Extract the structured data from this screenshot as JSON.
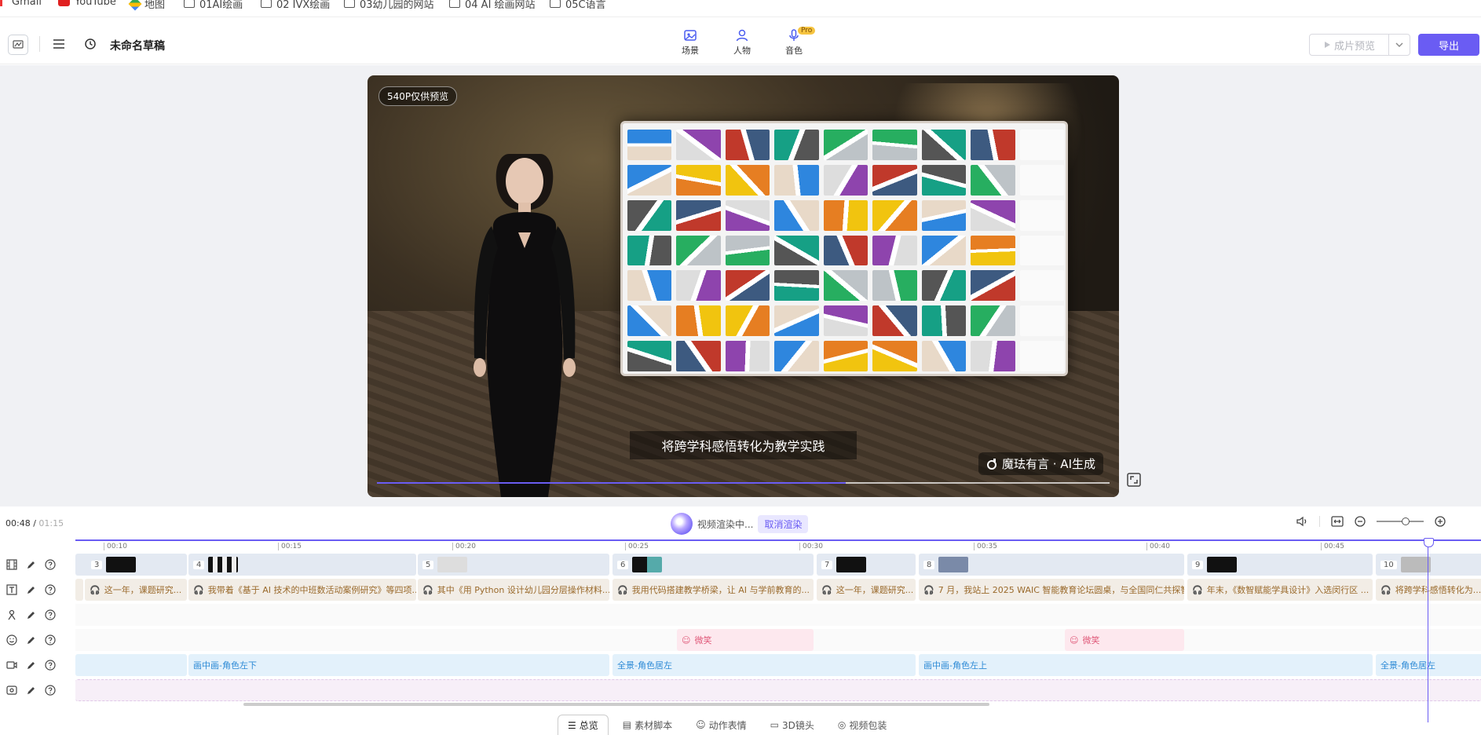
{
  "bookmarks": [
    "Gmail",
    "YouTube",
    "地图",
    "01AI绘画",
    "02 IVX绘画",
    "03幼儿园的网站",
    "04 AI 绘画网站",
    "05C语言"
  ],
  "topbar": {
    "title": "未命名草稿",
    "tabs": [
      {
        "label": "场景",
        "icon": "scene-icon"
      },
      {
        "label": "人物",
        "icon": "person-icon"
      },
      {
        "label": "音色",
        "icon": "mic-icon",
        "badge": "Pro"
      }
    ],
    "preview_label": "成片预览",
    "export_label": "导出",
    "accent": "#6a5cf3"
  },
  "preview": {
    "resolution_badge": "540P仅供预览",
    "subtitle": "将跨学科感悟转化为教学实践",
    "watermark": "魔珐有言 · AI生成",
    "progress": 0.64
  },
  "timeline": {
    "current_time": "00:48",
    "total_time": "01:15",
    "render_status": "视频渲染中...",
    "cancel_label": "取消渲染",
    "ticks": [
      "00:10",
      "00:15",
      "00:20",
      "00:25",
      "00:30",
      "00:35",
      "00:40",
      "00:45"
    ],
    "scene_numbers": [
      "3",
      "4",
      "5",
      "6",
      "7",
      "8",
      "9",
      "10"
    ],
    "script_segments": [
      "这一年，课题研究...",
      "我带着《基于 AI 技术的中班数活动案例研究》等四项...",
      "其中《用 Python 设计幼儿园分层操作材料...",
      "我用代码搭建教学桥梁，让 AI 与学前教育的...",
      "这一年，课题研究...",
      "7 月，我站上 2025 WAIC 智能教育论坛圆桌，与全国同仁共探智...",
      "年末，《数智赋能学具设计》入选闵行区 ...",
      "将跨学科感悟转化为..."
    ],
    "emotion_segments": [
      "微笑",
      "微笑"
    ],
    "camera_segments": [
      "画中画-角色左下",
      "全景-角色居左",
      "画中画-角色左上",
      "全景-角色居左"
    ]
  },
  "bottom_tabs": [
    "总览",
    "素材脚本",
    "动作表情",
    "3D镜头",
    "视频包装"
  ]
}
